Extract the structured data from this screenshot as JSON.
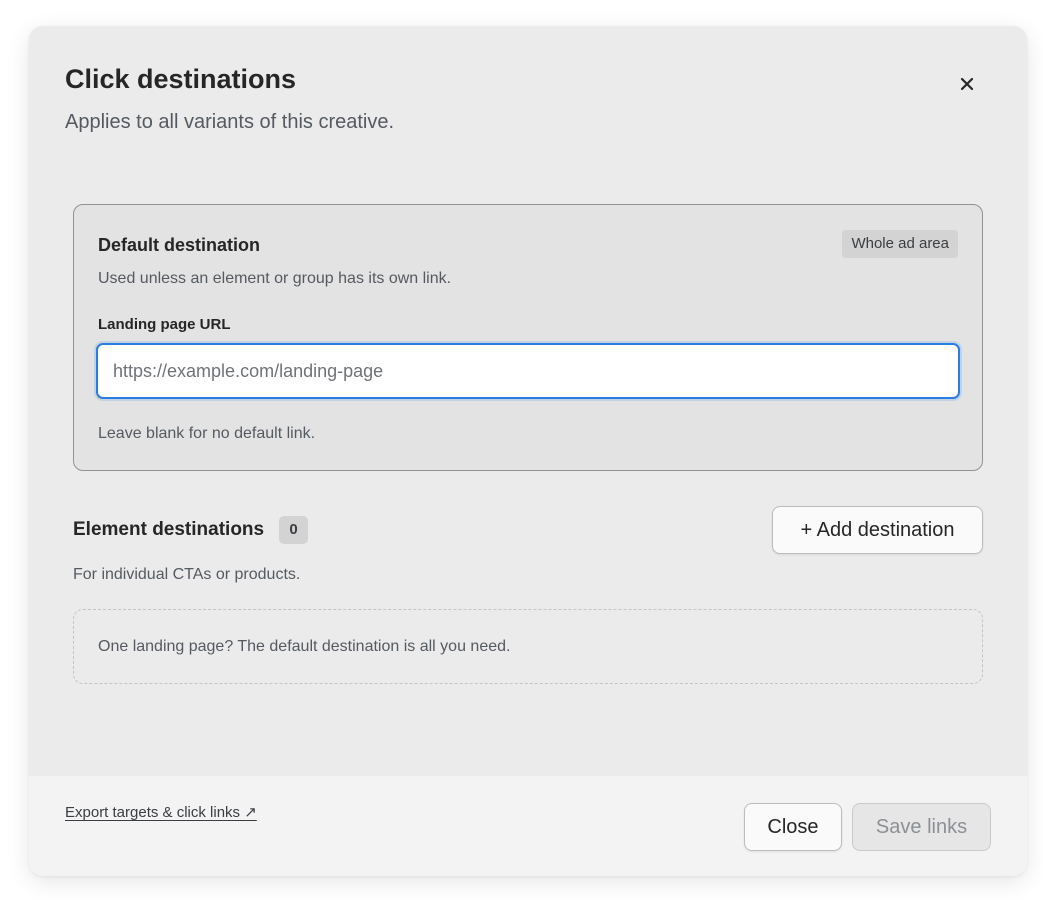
{
  "dialog": {
    "title": "Click destinations",
    "subtitle": "Applies to all variants of this creative.",
    "close_icon": "close-icon"
  },
  "default_destination": {
    "title": "Default destination",
    "badge": "Whole ad area",
    "description": "Used unless an element or group has its own link.",
    "url_label": "Landing page URL",
    "url_value": "",
    "url_placeholder": "https://example.com/landing-page",
    "help_text": "Leave blank for no default link."
  },
  "element_destinations": {
    "title": "Element destinations",
    "count": "0",
    "add_button_label": "+ Add destination",
    "description": "For individual CTAs or products.",
    "empty_text": "One landing page? The default destination is all you need."
  },
  "footer": {
    "export_link": "Export targets & click links ↗",
    "close_button": "Close",
    "save_button": "Save links",
    "save_disabled": true
  },
  "colors": {
    "modal_background": "#ebebeb",
    "focus_ring": "#2a7de1",
    "text_primary": "#262626",
    "text_secondary": "#555a60"
  }
}
